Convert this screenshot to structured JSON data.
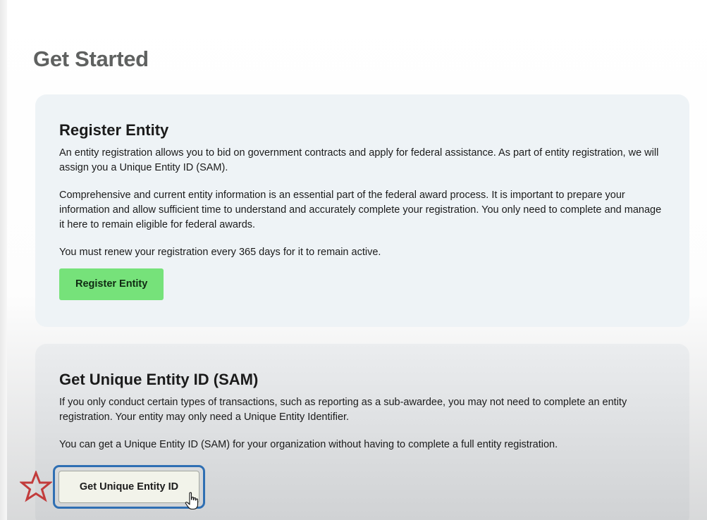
{
  "page": {
    "title": "Get Started"
  },
  "register": {
    "heading": "Register Entity",
    "paragraphs": [
      "An entity registration allows you to bid on government contracts and apply for federal assistance. As part of entity registration, we will assign you a Unique Entity ID (SAM).",
      "Comprehensive and current entity information is an essential part of the federal award process. It is important to prepare your information and allow sufficient time to understand and accurately complete your registration. You only need to complete and manage it here to remain eligible for federal awards.",
      "You must renew your registration every 365 days for it to remain active."
    ],
    "button_label": "Register Entity"
  },
  "uei": {
    "heading": "Get Unique Entity ID (SAM)",
    "paragraphs": [
      "If you only conduct certain types of transactions, such as reporting as a sub-awardee, you may not need to complete an entity registration. Your entity may only need a Unique Entity Identifier.",
      "You can get a Unique Entity ID (SAM) for your organization without having to complete a full entity registration."
    ],
    "button_label": "Get Unique Entity ID"
  },
  "colors": {
    "register_button": "#76e27a",
    "focus_ring": "#2f6fb3",
    "star_outline": "#c23b3b",
    "title_text": "#5f6160"
  },
  "icons": {
    "star": "star-outline-icon",
    "cursor": "hand-pointer-cursor-icon"
  }
}
